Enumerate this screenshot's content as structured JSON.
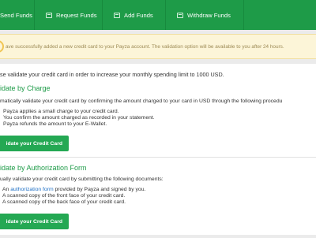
{
  "nav": {
    "items": [
      {
        "label": "Send Funds"
      },
      {
        "label": "Request Funds"
      },
      {
        "label": "Add Funds"
      },
      {
        "label": "Withdraw Funds"
      }
    ]
  },
  "alert": {
    "message": "ave successfully added a new credit card to your Payza account. The validation option will be available to you after 24 hours."
  },
  "intro": "se validate your credit card in order to increase your monthly spending limit to 1000 USD.",
  "charge": {
    "title": "idate by Charge",
    "description": "matically validate your credit card by confirming the amount charged to your card in USD through the following procedu",
    "steps": [
      "Payza applies a small charge to your credit card.",
      "You confirm the amount charged as recorded in your statement.",
      "Payza refunds the amount to your E-Wallet."
    ],
    "button": "idate your Credit Card"
  },
  "authorization": {
    "title": "idate by Authorization Form",
    "description": "ually validate your credit card by submitting the following documents:",
    "step1_prefix": "An",
    "step1_link": "authorization form",
    "step1_suffix": "provided by Payza and signed by you.",
    "steps": [
      "A scanned copy of the front face of your credit card.",
      "A scanned copy of the back face of your credit card."
    ],
    "button": "idate your Credit Card"
  },
  "colors": {
    "brand_green": "#1e9b48",
    "button_green": "#24a853",
    "link_blue": "#1e6fc5",
    "alert_bg": "#fcf5d8"
  }
}
